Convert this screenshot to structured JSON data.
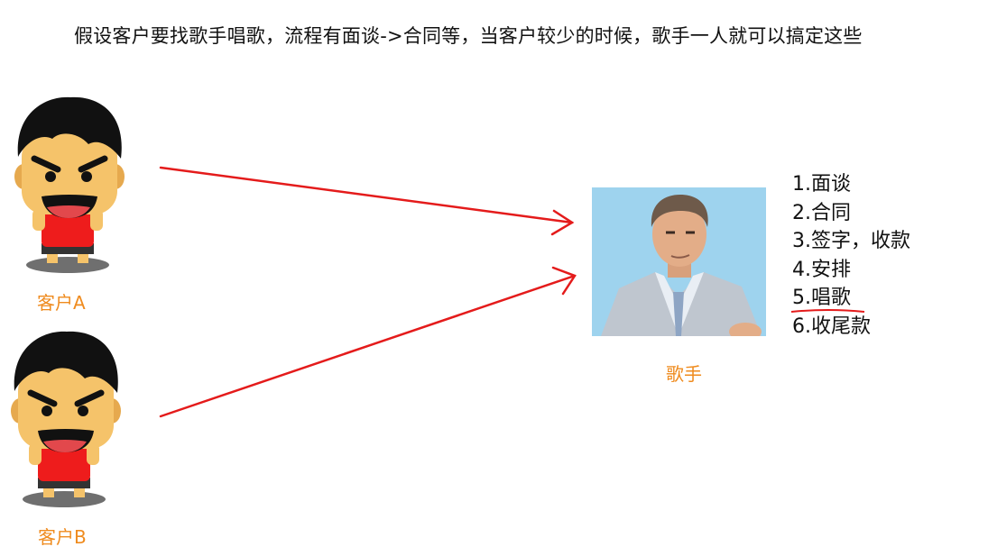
{
  "heading": "假设客户要找歌手唱歌，流程有面谈->合同等，当客户较少的时候，歌手一人就可以搞定这些",
  "clients": [
    {
      "label": "客户A"
    },
    {
      "label": "客户B"
    }
  ],
  "singer": {
    "label": "歌手"
  },
  "steps": [
    "1.面谈",
    "2.合同",
    "3.签字，收款",
    "4.安排",
    "5.唱歌",
    "6.收尾款"
  ],
  "colors": {
    "arrow": "#e41b1b",
    "label": "#ef8b1e",
    "skin": "#f5c36a",
    "shirt": "#ee1c1c",
    "photo_bg": "#9ed3ee"
  }
}
